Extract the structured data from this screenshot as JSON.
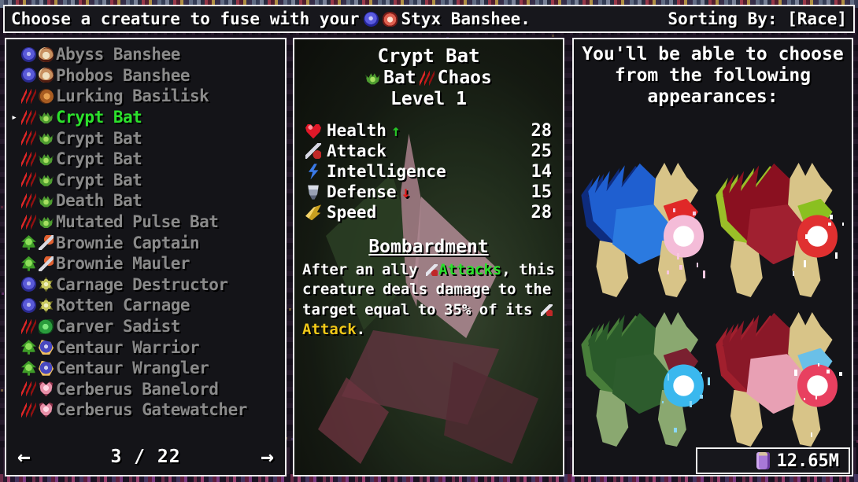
{
  "banner": {
    "prompt_prefix": "Choose a creature to fuse with your",
    "partner_icons": [
      "abyss-orb-icon",
      "banshee-face-icon"
    ],
    "partner_name": "Styx Banshee.",
    "sorting": "Sorting By: [Race]"
  },
  "list": {
    "items": [
      {
        "icons": [
          "abyss",
          "banshee"
        ],
        "name": "Abyss Banshee",
        "selected": false
      },
      {
        "icons": [
          "abyss",
          "banshee"
        ],
        "name": "Phobos Banshee",
        "selected": false
      },
      {
        "icons": [
          "chaos",
          "basilisk"
        ],
        "name": "Lurking Basilisk",
        "selected": false
      },
      {
        "icons": [
          "chaos",
          "bat"
        ],
        "name": "Crypt Bat",
        "selected": true
      },
      {
        "icons": [
          "chaos",
          "bat"
        ],
        "name": "Crypt Bat",
        "selected": false
      },
      {
        "icons": [
          "chaos",
          "bat"
        ],
        "name": "Crypt Bat",
        "selected": false
      },
      {
        "icons": [
          "chaos",
          "bat"
        ],
        "name": "Crypt Bat",
        "selected": false
      },
      {
        "icons": [
          "chaos",
          "bat"
        ],
        "name": "Death Bat",
        "selected": false
      },
      {
        "icons": [
          "chaos",
          "bat"
        ],
        "name": "Mutated Pulse Bat",
        "selected": false
      },
      {
        "icons": [
          "nature",
          "axe"
        ],
        "name": "Brownie Captain",
        "selected": false
      },
      {
        "icons": [
          "nature",
          "axe"
        ],
        "name": "Brownie Mauler",
        "selected": false
      },
      {
        "icons": [
          "abyss",
          "carnage"
        ],
        "name": "Carnage Destructor",
        "selected": false
      },
      {
        "icons": [
          "abyss",
          "carnage"
        ],
        "name": "Rotten Carnage",
        "selected": false
      },
      {
        "icons": [
          "chaos",
          "carver"
        ],
        "name": "Carver Sadist",
        "selected": false
      },
      {
        "icons": [
          "nature",
          "centaur"
        ],
        "name": "Centaur Warrior",
        "selected": false
      },
      {
        "icons": [
          "nature",
          "centaur"
        ],
        "name": "Centaur Wrangler",
        "selected": false
      },
      {
        "icons": [
          "chaos",
          "cerberus"
        ],
        "name": "Cerberus Banelord",
        "selected": false
      },
      {
        "icons": [
          "chaos",
          "cerberus"
        ],
        "name": "Cerberus Gatewatcher",
        "selected": false
      }
    ],
    "pager": {
      "prev_icon": "←",
      "next_icon": "→",
      "count": "3 / 22"
    }
  },
  "detail": {
    "name": "Crypt Bat",
    "race": "Bat",
    "element": "Chaos",
    "race_icon": "bat-icon",
    "element_icon": "chaos-icon",
    "level": "Level 1",
    "stats": [
      {
        "icon": "heart-icon",
        "label": "Health",
        "modifier": "up",
        "modifier_glyph": "↑",
        "value": "28"
      },
      {
        "icon": "sword-icon",
        "label": "Attack",
        "modifier": "none",
        "modifier_glyph": "",
        "value": "25"
      },
      {
        "icon": "lightning-icon",
        "label": "Intelligence",
        "modifier": "none",
        "modifier_glyph": "",
        "value": "14"
      },
      {
        "icon": "shield-icon",
        "label": "Defense",
        "modifier": "down",
        "modifier_glyph": "↓",
        "value": "15"
      },
      {
        "icon": "wing-icon",
        "label": "Speed",
        "modifier": "none",
        "modifier_glyph": "",
        "value": "28"
      }
    ],
    "ability": {
      "title": "Bombardment",
      "text_part_1": "After an ally ",
      "keyword_1": "Attacks",
      "text_part_2": ", this creature deals damage to the target equal to 35% of its ",
      "keyword_2": "Attack",
      "text_part_3": "."
    }
  },
  "appearances": {
    "title": "You'll be able to choose from the following appearances:",
    "variants": [
      {
        "name": "blue-gold-variant",
        "mane": "#1f5fd0",
        "mane2": "#0d2f8a",
        "body": "#2b7ae0",
        "accent": "#d8c488",
        "trim": "#e02828",
        "orb": "#f4bcd8",
        "orb_core": "#ffffff",
        "spark": "#f8c8e0"
      },
      {
        "name": "red-green-variant",
        "mane": "#8a1020",
        "mane2": "#a8d02a",
        "body": "#a02030",
        "accent": "#d8c488",
        "trim": "#8ac020",
        "orb": "#e03030",
        "orb_core": "#ffffff",
        "spark": "#ffffff"
      },
      {
        "name": "green-variant",
        "mane": "#2a5a2a",
        "mane2": "#4e8a3e",
        "body": "#2d5c2d",
        "accent": "#8aa870",
        "trim": "#7a2030",
        "orb": "#3ab8ee",
        "orb_core": "#ffffff",
        "spark": "#8ad8f8"
      },
      {
        "name": "pink-crimson-variant",
        "mane": "#8a1828",
        "mane2": "#b02030",
        "body": "#e8a0b4",
        "accent": "#d8c488",
        "trim": "#6ac0e8",
        "orb": "#e84060",
        "orb_core": "#ffffff",
        "spark": "#ffffff"
      }
    ]
  },
  "currency": {
    "icon": "vial-icon",
    "amount": "12.65M"
  }
}
